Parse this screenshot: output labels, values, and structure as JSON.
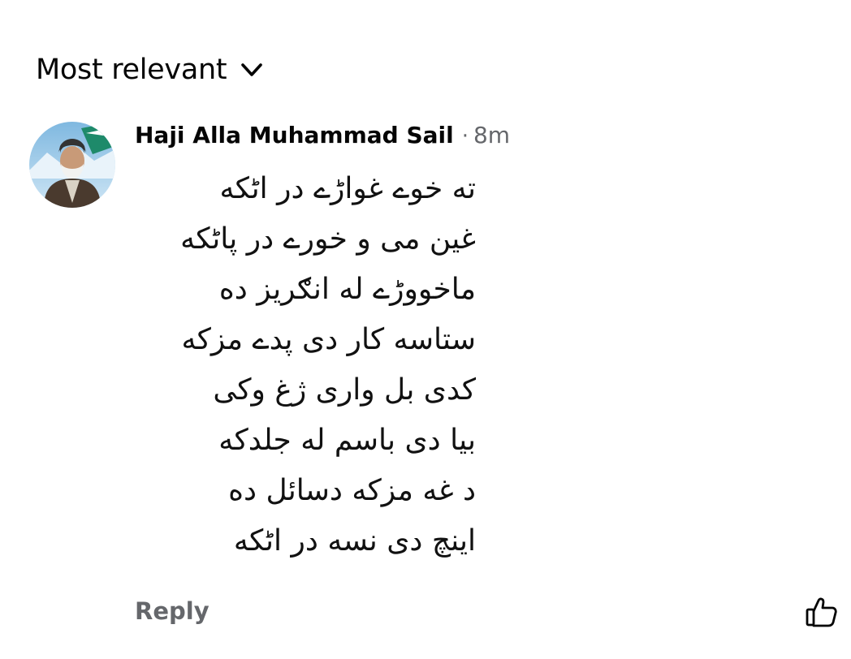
{
  "sort": {
    "label": "Most relevant",
    "icon": "chevron-down-icon"
  },
  "comment": {
    "author": "Haji Alla Muhammad Sail",
    "separator": "·",
    "time": "8m",
    "lines": [
      "ته خوے غواڑے در اٹکه",
      "غین می و خورے در پاٹکه",
      "ماخووڑے له انګریز ده",
      "ستاسه کار دی پدے مزکه",
      "کدی بل واری ژغ وکی",
      "بیا دی باسم له جلدکه",
      "د غه مزکه دسائل ده",
      "اینچ دی نسه در اٹکه"
    ],
    "reply_label": "Reply",
    "like_icon": "thumbs-up-icon"
  },
  "colors": {
    "primary_text": "#050505",
    "secondary_text": "#65676b"
  }
}
